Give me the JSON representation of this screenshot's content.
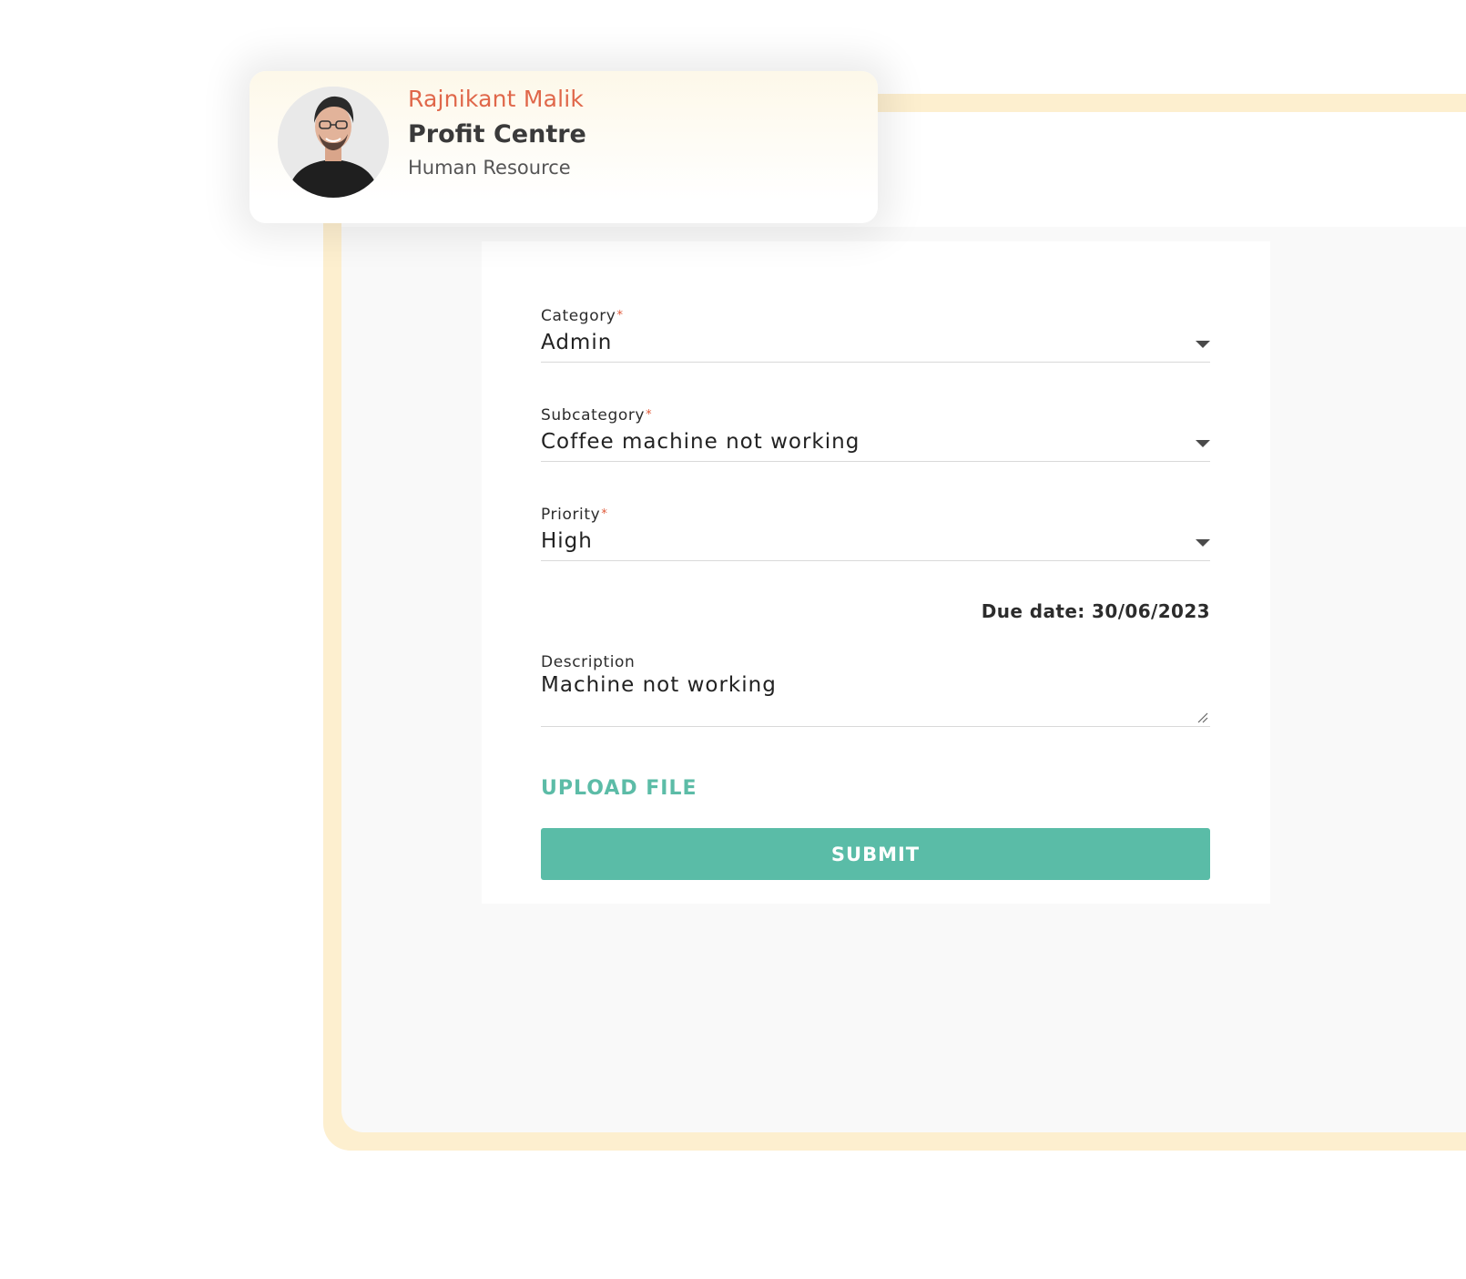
{
  "profile": {
    "name": "Rajnikant Malik",
    "role": "Profit Centre",
    "department": "Human Resource"
  },
  "form": {
    "category": {
      "label": "Category",
      "required_mark": "*",
      "value": "Admin"
    },
    "subcategory": {
      "label": "Subcategory",
      "required_mark": "*",
      "value": "Coffee machine not working"
    },
    "priority": {
      "label": "Priority",
      "required_mark": "*",
      "value": "High"
    },
    "due_date": "Due date: 30/06/2023",
    "description": {
      "label": "Description",
      "value": "Machine not working"
    },
    "upload_label": "UPLOAD FILE",
    "submit_label": "SUBMIT"
  },
  "colors": {
    "accent": "#5abca7",
    "name_color": "#e0674a",
    "frame": "#fdefcf",
    "required": "#e05a3a"
  },
  "icons": {
    "dropdown": "chevron-down-icon",
    "resize": "resize-grip-icon"
  }
}
